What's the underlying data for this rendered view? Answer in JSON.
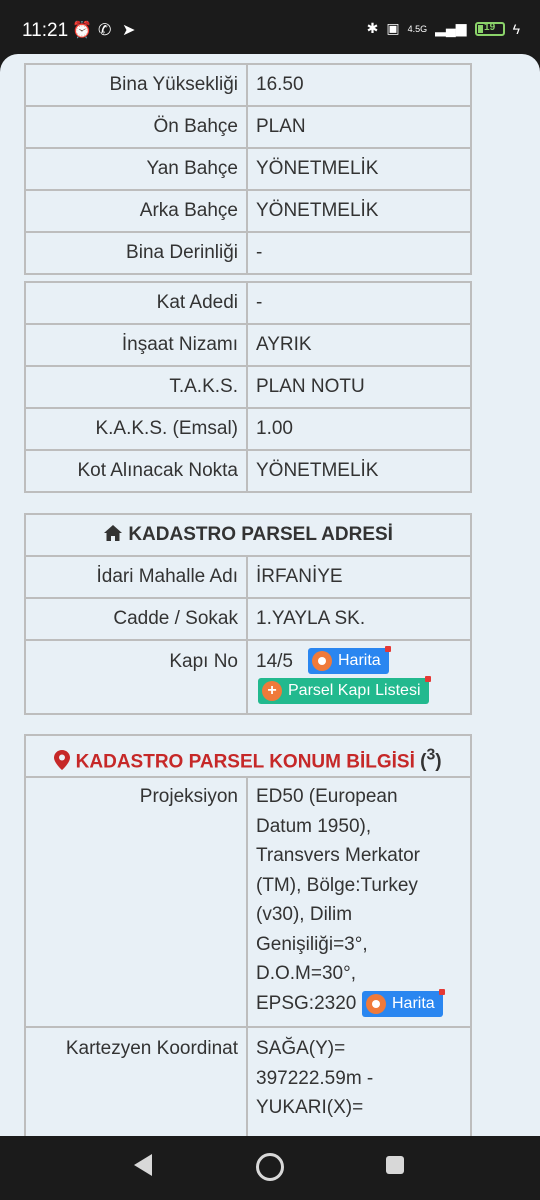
{
  "status_bar": {
    "time": "11:21",
    "network": "4.5G",
    "battery": "19"
  },
  "table1": [
    {
      "label": "Bina Yüksekliği",
      "value": "16.50"
    },
    {
      "label": "Ön Bahçe",
      "value": "PLAN"
    },
    {
      "label": "Yan Bahçe",
      "value": "YÖNETMELİK"
    },
    {
      "label": "Arka Bahçe",
      "value": "YÖNETMELİK"
    },
    {
      "label": "Bina Derinliği",
      "value": "-"
    }
  ],
  "table2": [
    {
      "label": "Kat Adedi",
      "value": "-"
    },
    {
      "label": "İnşaat Nizamı",
      "value": "AYRIK"
    },
    {
      "label": "T.A.K.S.",
      "value": "PLAN NOTU"
    },
    {
      "label": "K.A.K.S. (Emsal)",
      "value": "1.00"
    },
    {
      "label": "Kot Alınacak Nokta",
      "value": "YÖNETMELİK"
    }
  ],
  "address": {
    "title": "KADASTRO PARSEL ADRESİ",
    "mahalle_label": "İdari Mahalle Adı",
    "mahalle_value": "İRFANİYE",
    "cadde_label": "Cadde / Sokak",
    "cadde_value": "1.YAYLA SK.",
    "kapi_label": "Kapı No",
    "kapi_value": "14/5",
    "harita_label": "Harita",
    "parsel_list_label": "Parsel Kapı Listesi"
  },
  "location": {
    "title": "KADASTRO PARSEL KONUM BİLGİSİ",
    "title_sup": "3",
    "projeksiyon_label": "Projeksiyon",
    "projeksiyon_lines": [
      "ED50 (European",
      "Datum 1950),",
      "Transvers Merkator",
      "(TM), Bölge:Turkey",
      "(v30), Dilim",
      "Genişiliği=3°,",
      "D.O.M=30°,"
    ],
    "projeksiyon_last": "EPSG:2320",
    "harita_label": "Harita",
    "kartezyen_label": "Kartezyen Koordinat",
    "kartezyen_lines": [
      "SAĞA(Y)=",
      "397222.59m -",
      "YUKARI(X)="
    ]
  },
  "colors": {
    "header_red": "#c62828",
    "button_blue": "#2a86f0",
    "button_green": "#22b98e"
  }
}
